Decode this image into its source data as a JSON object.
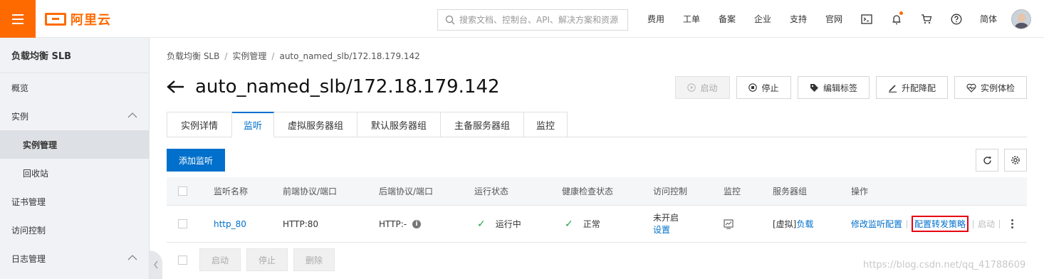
{
  "header": {
    "brand": "阿里云",
    "search_placeholder": "搜索文档、控制台、API、解决方案和资源",
    "nav": [
      "费用",
      "工单",
      "备案",
      "企业",
      "支持",
      "官网"
    ],
    "language": "简体"
  },
  "sidebar": {
    "title": "负载均衡 SLB",
    "items": [
      {
        "label": "概览"
      },
      {
        "label": "实例"
      },
      {
        "label": "实例管理"
      },
      {
        "label": "回收站"
      },
      {
        "label": "证书管理"
      },
      {
        "label": "访问控制"
      },
      {
        "label": "日志管理"
      }
    ]
  },
  "breadcrumb": [
    "负载均衡 SLB",
    "实例管理",
    "auto_named_slb/172.18.179.142"
  ],
  "page_title": "auto_named_slb/172.18.179.142",
  "actions": {
    "start": "启动",
    "stop": "停止",
    "edit_tags": "编辑标签",
    "upgrade": "升配降配",
    "health_check": "实例体检"
  },
  "tabs": [
    "实例详情",
    "监听",
    "虚拟服务器组",
    "默认服务器组",
    "主备服务器组",
    "监控"
  ],
  "add_listener": "添加监听",
  "table": {
    "headers": [
      "监听名称",
      "前端协议/端口",
      "后端协议/端口",
      "运行状态",
      "健康检查状态",
      "访问控制",
      "监控",
      "服务器组",
      "操作"
    ],
    "rows": [
      {
        "name": "http_80",
        "frontend": "HTTP:80",
        "backend": "HTTP:-",
        "run_status": "运行中",
        "health_status": "正常",
        "access_control": "未开启",
        "access_control_link": "设置",
        "server_group_prefix": "[虚拟]",
        "server_group_link": "负载",
        "op_modify": "修改监听配置",
        "op_forward": "配置转发策略",
        "op_start": "启动"
      }
    ]
  },
  "bottom_actions": {
    "start": "启动",
    "stop": "停止",
    "delete": "删除"
  },
  "watermark": "https://blog.csdn.net/qq_41788609",
  "colors": {
    "brand_orange": "#ff6a00",
    "primary_blue": "#0070cc",
    "success_green": "#1fa64a",
    "highlight_red": "#e60012"
  }
}
